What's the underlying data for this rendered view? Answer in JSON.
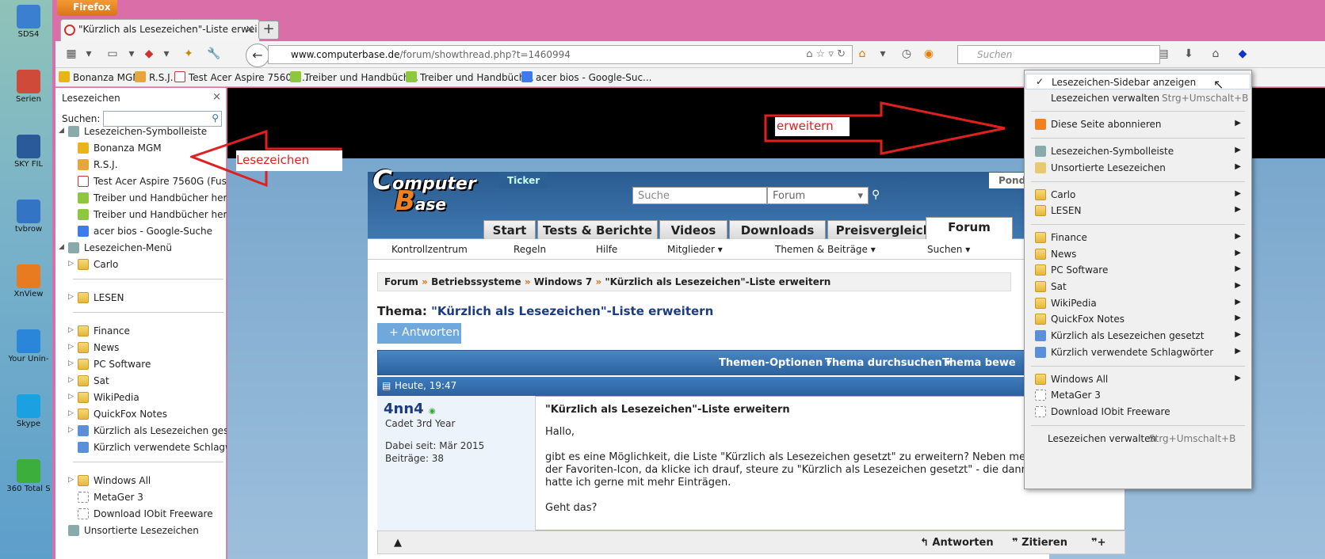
{
  "desktop": {
    "icons": [
      "SDS4",
      "Serien",
      "SKY FIL",
      "tvbrow",
      "XnView",
      "Your Unin-",
      "Skype",
      "360 Total S"
    ]
  },
  "browser": {
    "app_button": "Firefox",
    "tab_title": "\"Kürzlich als Lesezeichen\"-Liste erwei...",
    "url_host": "www.computerbase.de",
    "url_path": "/forum/showthread.php?t=1460994",
    "search_placeholder": "Suchen"
  },
  "bookmarks_toolbar": [
    "Bonanza MGM",
    "R.S.J.",
    "Test Acer Aspire 7560G...",
    "Treiber und Handbüch...",
    "Treiber und Handbüch...",
    "acer bios - Google-Suc..."
  ],
  "sidebar": {
    "title": "Lesezeichen",
    "close": "×",
    "search_label": "Suchen:",
    "items": [
      {
        "label": "Lesezeichen-Symbolleiste",
        "level": 0,
        "type": "root",
        "twisty": "◢"
      },
      {
        "label": "Bonanza MGM",
        "level": 1,
        "type": "bookmark"
      },
      {
        "label": "R.S.J.",
        "level": 1,
        "type": "bookmark"
      },
      {
        "label": "Test Acer Aspire 7560G (Fusio...",
        "level": 1,
        "type": "bookmark"
      },
      {
        "label": "Treiber und Handbücher heru...",
        "level": 1,
        "type": "bookmark"
      },
      {
        "label": "Treiber und Handbücher heru...",
        "level": 1,
        "type": "bookmark"
      },
      {
        "label": "acer bios - Google-Suche",
        "level": 1,
        "type": "bookmark"
      },
      {
        "label": "Lesezeichen-Menü",
        "level": 0,
        "type": "root",
        "twisty": "◢"
      },
      {
        "label": "Carlo",
        "level": 1,
        "type": "folder",
        "twisty": "▷"
      },
      {
        "label": "LESEN",
        "level": 1,
        "type": "folder",
        "twisty": "▷"
      },
      {
        "label": "Finance",
        "level": 1,
        "type": "folder",
        "twisty": "▷"
      },
      {
        "label": "News",
        "level": 1,
        "type": "folder",
        "twisty": "▷"
      },
      {
        "label": "PC Software",
        "level": 1,
        "type": "folder",
        "twisty": "▷"
      },
      {
        "label": "Sat",
        "level": 1,
        "type": "folder",
        "twisty": "▷"
      },
      {
        "label": "WikiPedia",
        "level": 1,
        "type": "folder",
        "twisty": "▷"
      },
      {
        "label": "QuickFox Notes",
        "level": 1,
        "type": "folder",
        "twisty": "▷"
      },
      {
        "label": "Kürzlich als Lesezeichen gesetzt",
        "level": 1,
        "type": "query",
        "twisty": "▷"
      },
      {
        "label": "Kürzlich verwendete Schlagw...",
        "level": 1,
        "type": "query"
      },
      {
        "label": "Windows All",
        "level": 1,
        "type": "folder",
        "twisty": "▷"
      },
      {
        "label": "MetaGer 3",
        "level": 1,
        "type": "blank"
      },
      {
        "label": "Download IObit Freeware",
        "level": 1,
        "type": "blank"
      },
      {
        "label": "Unsortierte Lesezeichen",
        "level": 0,
        "type": "root"
      }
    ]
  },
  "annotations": {
    "left": "Lesezeichen",
    "right": "erweitern"
  },
  "site": {
    "logo_main": "omputer",
    "logo_c": "C",
    "logo_b": "B",
    "logo_ase": "ase",
    "ticker": "Ticker",
    "search_placeholder": "Suche",
    "search_scope": "Forum",
    "pond": "Pond",
    "tabs": [
      "Start",
      "Tests & Berichte",
      "Videos",
      "Downloads",
      "Preisvergleich",
      "Forum"
    ],
    "subnav": [
      "Kontrollzentrum",
      "Regeln",
      "Hilfe",
      "Mitglieder ▾",
      "Themen & Beiträge ▾",
      "Suchen ▾"
    ],
    "breadcrumb": [
      "Forum",
      "Betriebssysteme",
      "Windows 7",
      "\"Kürzlich als Lesezeichen\"-Liste erweitern"
    ],
    "thread_label": "Thema:",
    "thread_title": "\"Kürzlich als Lesezeichen\"-Liste erweitern",
    "reply_button": "+ Antworten",
    "options": [
      "Themen-Optionen ▾",
      "Thema durchsuchen ▾",
      "Thema bewe"
    ],
    "post": {
      "date": "Heute, 19:47",
      "username": "4nn4",
      "rank": "Cadet 3rd Year",
      "joined": "Dabei seit: Mär 2015",
      "posts": "Beiträge: 38",
      "title": "\"Kürzlich als Lesezeichen\"-Liste erweitern",
      "greeting": "Hallo,",
      "line1": "gibt es eine Möglichkeit, die Liste \"Kürzlich als Lesezeichen gesetzt\" zu erweitern? Neben meine",
      "line2": "der Favoriten-Icon, da klicke ich drauf, steure zu \"Kürzlich als Lesezeichen gesetzt\" - die dann er",
      "line3": "hatte ich gerne mit mehr Einträgen.",
      "question": "Geht das?",
      "reply": "Antworten",
      "quote": "Zitieren"
    }
  },
  "bookmarks_menu": {
    "items": [
      {
        "label": "Lesezeichen-Sidebar anzeigen",
        "checked": true
      },
      {
        "label": "Lesezeichen verwalten",
        "shortcut": "Strg+Umschalt+B"
      },
      {
        "label": "Diese Seite abonnieren",
        "submenu": true
      },
      {
        "label": "Lesezeichen-Symbolleiste",
        "submenu": true
      },
      {
        "label": "Unsortierte Lesezeichen",
        "submenu": true
      },
      {
        "label": "Carlo",
        "submenu": true
      },
      {
        "label": "LESEN",
        "submenu": true
      },
      {
        "label": "Finance",
        "submenu": true
      },
      {
        "label": "News",
        "submenu": true
      },
      {
        "label": "PC Software",
        "submenu": true
      },
      {
        "label": "Sat",
        "submenu": true
      },
      {
        "label": "WikiPedia",
        "submenu": true
      },
      {
        "label": "QuickFox Notes",
        "submenu": true
      },
      {
        "label": "Kürzlich als Lesezeichen gesetzt",
        "submenu": true
      },
      {
        "label": "Kürzlich verwendete Schlagwörter",
        "submenu": true
      },
      {
        "label": "Windows All",
        "submenu": true
      },
      {
        "label": "MetaGer 3"
      },
      {
        "label": "Download IObit Freeware"
      },
      {
        "label": "Lesezeichen verwalten",
        "shortcut": "Strg+Umschalt+B"
      }
    ]
  }
}
